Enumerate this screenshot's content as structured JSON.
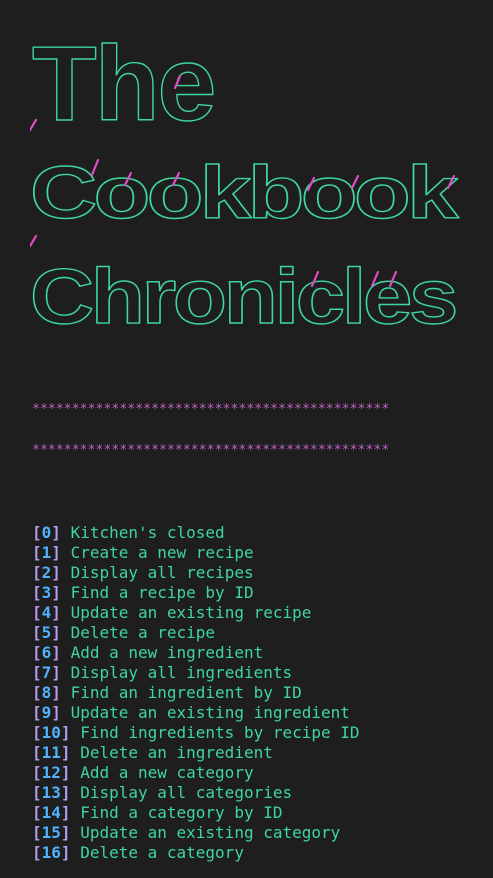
{
  "banner": {
    "lines": [
      "The",
      "Cookbook",
      "Chronicles"
    ],
    "colors": {
      "main": "#3ed6a0",
      "accent": "#e14bc4"
    }
  },
  "divider": {
    "text": "*********************************************",
    "color": "#c55fc8"
  },
  "menu": {
    "colors": {
      "bracket": "#b59cf0",
      "number": "#4fb3ff",
      "label": "#3ed6a0"
    },
    "items": [
      {
        "num": "0",
        "label": "Kitchen's closed"
      },
      {
        "num": "1",
        "label": "Create a new recipe"
      },
      {
        "num": "2",
        "label": "Display all recipes"
      },
      {
        "num": "3",
        "label": "Find a recipe by ID"
      },
      {
        "num": "4",
        "label": "Update an existing recipe"
      },
      {
        "num": "5",
        "label": "Delete a recipe"
      },
      {
        "num": "6",
        "label": "Add a new ingredient"
      },
      {
        "num": "7",
        "label": "Display all ingredients"
      },
      {
        "num": "8",
        "label": "Find an ingredient by ID"
      },
      {
        "num": "9",
        "label": "Update an existing ingredient"
      },
      {
        "num": "10",
        "label": "Find ingredients by recipe ID"
      },
      {
        "num": "11",
        "label": "Delete an ingredient"
      },
      {
        "num": "12",
        "label": "Add a new category"
      },
      {
        "num": "13",
        "label": "Display all categories"
      },
      {
        "num": "14",
        "label": "Find a category by ID"
      },
      {
        "num": "15",
        "label": "Update an existing category"
      },
      {
        "num": "16",
        "label": "Delete a category"
      }
    ]
  }
}
